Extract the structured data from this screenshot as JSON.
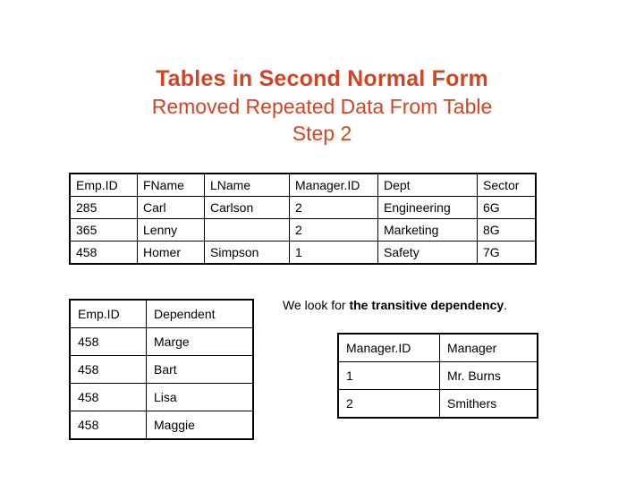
{
  "title": {
    "line1": "Tables in Second Normal Form",
    "line2": "Removed Repeated Data From Table",
    "line3": "Step 2",
    "color": "#d14524"
  },
  "employee_table": {
    "headers": [
      "Emp.ID",
      "FName",
      "LName",
      "Manager.ID",
      "Dept",
      "Sector"
    ],
    "rows": [
      [
        "285",
        "Carl",
        "Carlson",
        "2",
        "Engineering",
        "6G"
      ],
      [
        "365",
        "Lenny",
        "",
        "2",
        "Marketing",
        "8G"
      ],
      [
        "458",
        "Homer",
        "Simpson",
        "1",
        "Safety",
        "7G"
      ]
    ]
  },
  "dependent_table": {
    "headers": [
      "Emp.ID",
      "Dependent"
    ],
    "rows": [
      [
        "458",
        "Marge"
      ],
      [
        "458",
        "Bart"
      ],
      [
        "458",
        "Lisa"
      ],
      [
        "458",
        "Maggie"
      ]
    ]
  },
  "manager_table": {
    "headers": [
      "Manager.ID",
      "Manager"
    ],
    "rows": [
      [
        "1",
        "Mr. Burns"
      ],
      [
        "2",
        "Smithers"
      ]
    ]
  },
  "note": {
    "prefix": "We look for ",
    "emphasis": "the transitive dependency",
    "suffix": "."
  }
}
